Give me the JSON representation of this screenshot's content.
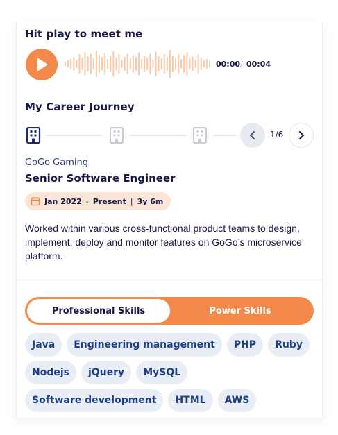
{
  "audio": {
    "title": "Hit play to meet me",
    "current_time": "00:00",
    "separator": "/",
    "duration": "00:04",
    "accent": "#f2884a"
  },
  "career": {
    "title": "My Career Journey",
    "pager": "1/6",
    "company": "GoGo Gaming",
    "role": "Senior Software Engineer",
    "date_start": "Jan 2022",
    "date_end": "Present",
    "duration": "3y 6m",
    "description": "Worked within various cross-functional product teams to design, implement, deploy and monitor features on GoGo’s microservice platform."
  },
  "skills": {
    "tabs": [
      {
        "label": "Professional Skills",
        "active": true
      },
      {
        "label": "Power Skills",
        "active": false
      }
    ],
    "rows": [
      [
        "Java",
        "Engineering management",
        "PHP",
        "Ruby"
      ],
      [
        "Nodejs",
        "jQuery",
        "MySQL"
      ],
      [
        "Software development",
        "HTML",
        "AWS"
      ]
    ]
  },
  "icons": {
    "play": "play-icon",
    "building": "building-icon",
    "prev": "chevron-left-icon",
    "next": "chevron-right-icon",
    "calendar": "calendar-icon"
  }
}
